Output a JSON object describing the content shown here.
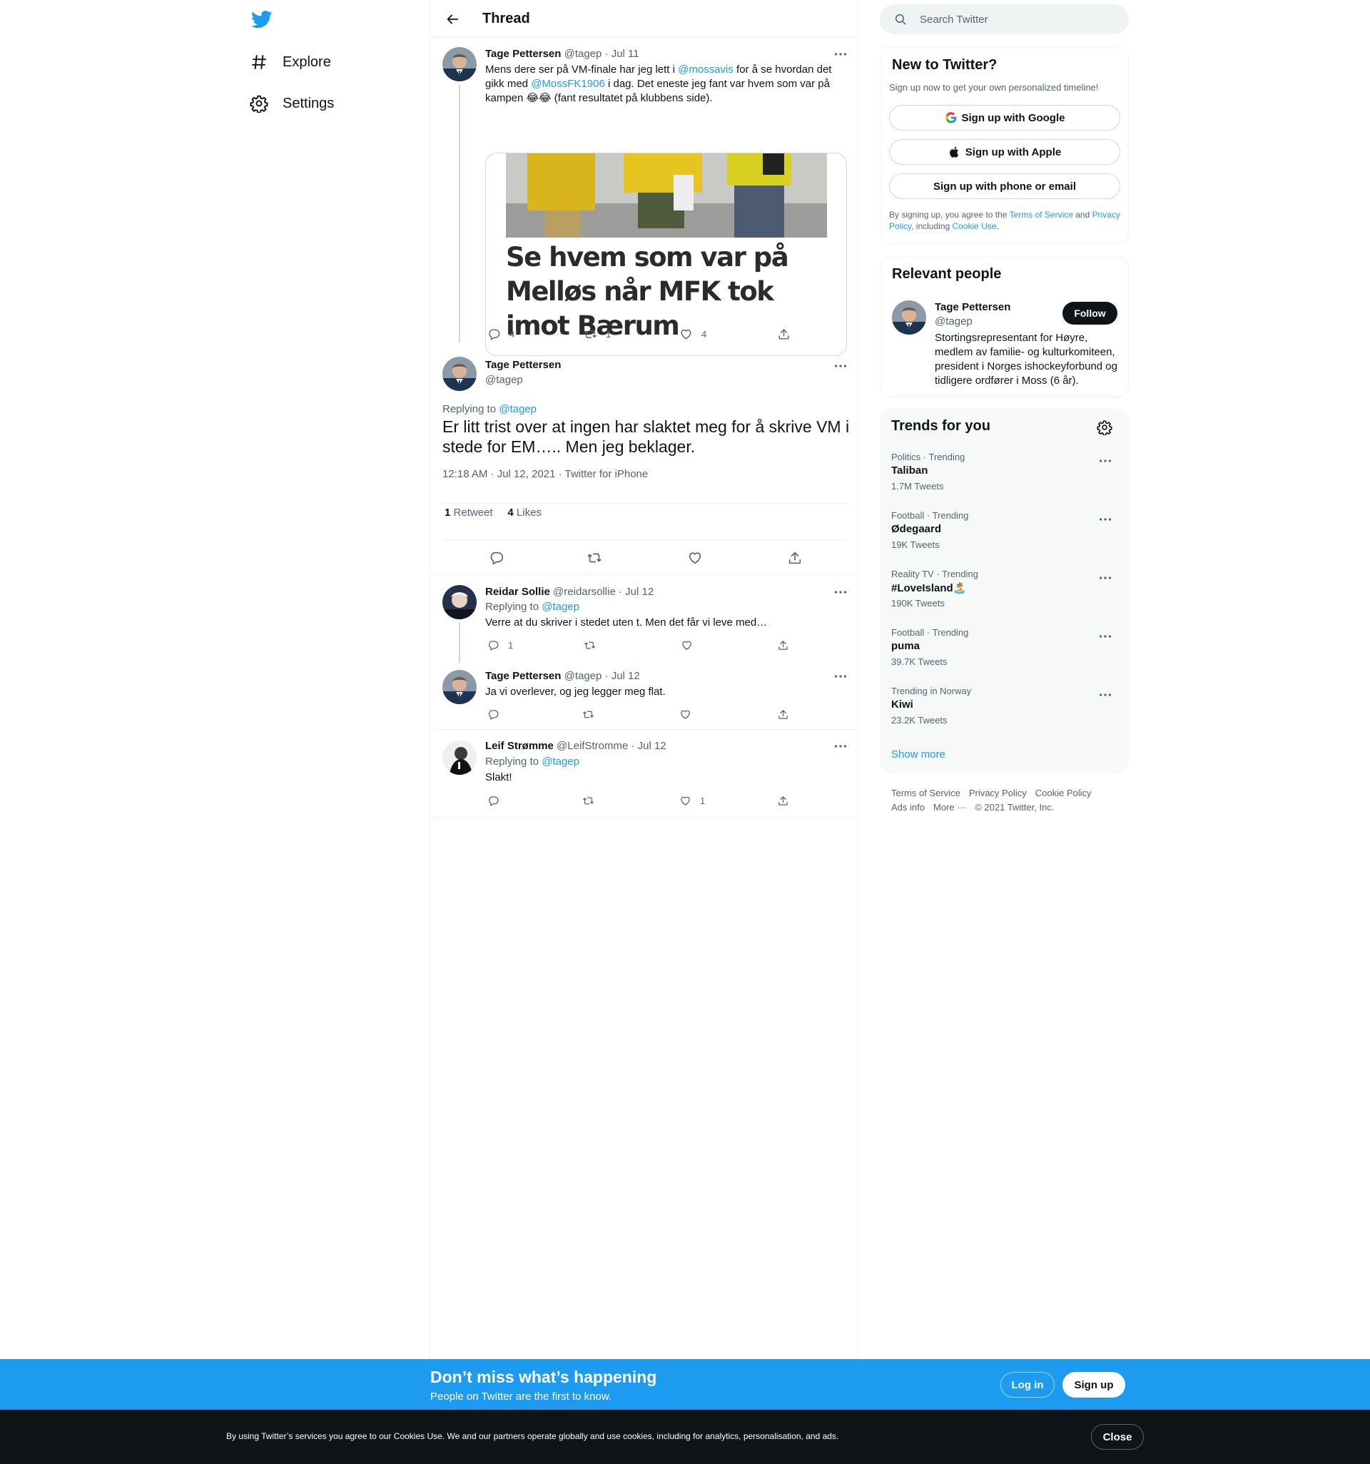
{
  "nav": {
    "explore_label": "Explore",
    "settings_label": "Settings"
  },
  "header": {
    "title": "Thread"
  },
  "tweets": {
    "t1": {
      "name": "Tage Pettersen",
      "meta": "@tagep · Jul 11",
      "text_before1": "Mens dere ser på VM-finale har jeg lett i ",
      "mention1": "@mossavis",
      "text_mid": " for å se hvordan det gikk med ",
      "mention2": "@MossFK1906",
      "text_after": " i dag. Det eneste jeg fant var hvem som var på kampen 😂😂 (fant resultatet på klubbens side).",
      "card_headline": "Se hvem som var på Melløs når MFK tok imot Bærum",
      "replies": "4",
      "retweets": "1",
      "likes": "4"
    },
    "main": {
      "name": "Tage Pettersen",
      "handle": "@tagep",
      "replying_label": "Replying to",
      "replying_to": "@tagep",
      "text": "Er litt trist over at ingen har slaktet meg for å skrive VM i stede for EM….. Men jeg beklager.",
      "time": "12:18 AM · Jul 12, 2021 · Twitter for iPhone",
      "retweet_count": "1",
      "retweet_label": "Retweet",
      "like_count": "4",
      "like_label": "Likes"
    },
    "t3": {
      "name": "Reidar Sollie",
      "meta": "@reidarsollie · Jul 12",
      "replying_label": "Replying to",
      "replying_to": "@tagep",
      "text": "Verre at du skriver i stedet uten t. Men det får vi leve med…",
      "replies": "1"
    },
    "t4": {
      "name": "Tage Pettersen",
      "meta": "@tagep · Jul 12",
      "text": "Ja vi overlever, og jeg legger meg flat."
    },
    "t5": {
      "name": "Leif Strømme",
      "meta": "@LeifStromme · Jul 12",
      "replying_label": "Replying to",
      "replying_to": "@tagep",
      "text": "Slakt!",
      "likes": "1"
    }
  },
  "search": {
    "placeholder": "Search Twitter"
  },
  "new_to_twitter": {
    "title": "New to Twitter?",
    "subtitle": "Sign up now to get your own personalized timeline!",
    "google_label": "Sign up with Google",
    "apple_label": "Sign up with Apple",
    "phone_label": "Sign up with phone or email",
    "legal_1": "By signing up, you agree to the ",
    "legal_terms": "Terms of Service",
    "legal_2": " and ",
    "legal_privacy": "Privacy Policy",
    "legal_3": ", including ",
    "legal_cookie": "Cookie Use",
    "legal_4": "."
  },
  "relevant_people": {
    "title": "Relevant people",
    "name": "Tage Pettersen",
    "handle": "@tagep",
    "bio": "Stortingsrepresentant for Høyre, medlem av familie- og kulturkomiteen, president i Norges ishockeyforbund og tidligere ordfører i Moss (6 år).",
    "follow_label": "Follow"
  },
  "trends": {
    "title": "Trends for you",
    "items": [
      {
        "context": "Politics · Trending",
        "name": "Taliban",
        "count": "1.7M Tweets"
      },
      {
        "context": "Football · Trending",
        "name": "Ødegaard",
        "count": "19K Tweets"
      },
      {
        "context": "Reality TV · Trending",
        "name": "#LoveIsland🏝️",
        "count": "190K Tweets"
      },
      {
        "context": "Football · Trending",
        "name": "puma",
        "count": "39.7K Tweets"
      },
      {
        "context": "Trending in Norway",
        "name": "Kiwi",
        "count": "23.2K Tweets"
      }
    ],
    "show_more": "Show more"
  },
  "footer": {
    "terms": "Terms of Service",
    "privacy": "Privacy Policy",
    "cookie": "Cookie Policy",
    "ads": "Ads info",
    "more": "More ···",
    "copyright": "© 2021 Twitter, Inc."
  },
  "bottom_bar": {
    "heading": "Don’t miss what’s happening",
    "subheading": "People on Twitter are the first to know.",
    "login_label": "Log in",
    "signup_label": "Sign up"
  },
  "cookie_bar": {
    "text": "By using Twitter’s services you agree to our Cookies Use. We and our partners operate globally and use cookies, including for analytics, personalisation, and ads.",
    "close_label": "Close"
  },
  "colors": {
    "accent": "#1d9bf0",
    "text": "#0f1419",
    "muted": "#536471",
    "border": "#eff3f4"
  }
}
